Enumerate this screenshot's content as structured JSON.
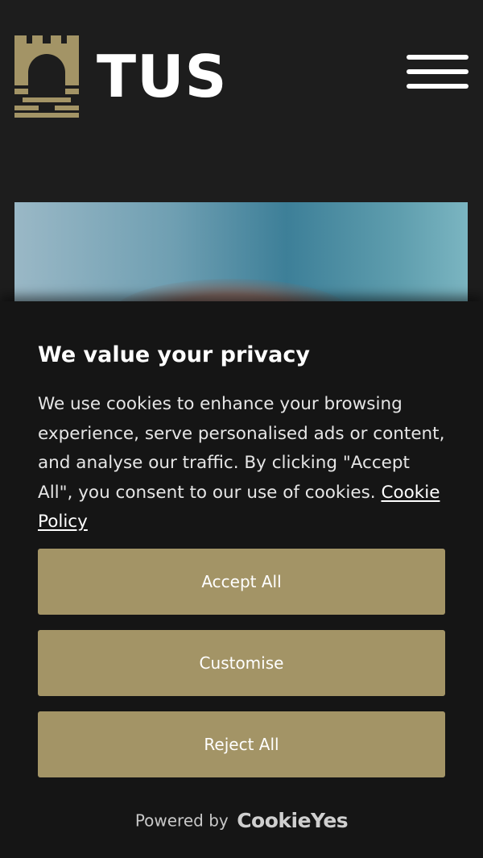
{
  "header": {
    "logo_icon": "castle-logo-icon",
    "brand_name": "TUS",
    "menu_icon": "hamburger-menu-icon"
  },
  "hero": {
    "image": "hero-photo"
  },
  "cookie_banner": {
    "title": "We value your privacy",
    "body": "We use cookies to enhance your browsing experience, serve personalised ads or content, and analyse our traffic. By clicking \"Accept All\", you consent to our use of cookies.",
    "policy_link": "Cookie Policy",
    "buttons": {
      "accept": "Accept All",
      "customise": "Customise",
      "reject": "Reject All"
    },
    "powered_by": "Powered by",
    "provider": "CookieYes"
  },
  "colors": {
    "background": "#1d1d1d",
    "banner": "#151515",
    "accent": "#a39466",
    "text": "#ffffff"
  }
}
